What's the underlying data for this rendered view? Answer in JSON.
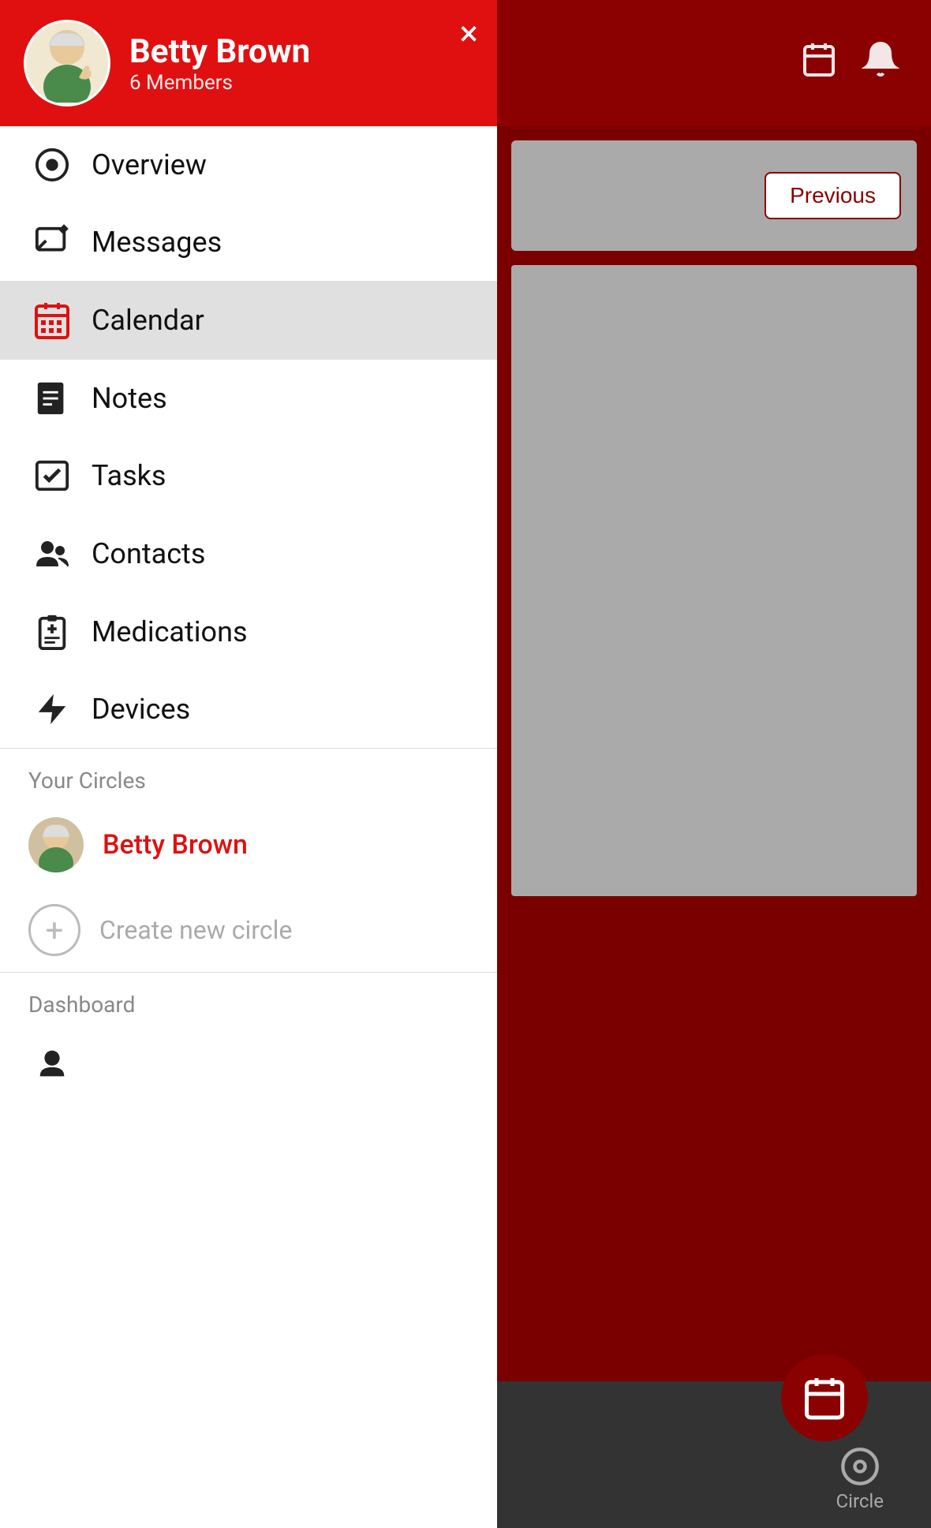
{
  "header": {
    "user_name": "Betty Brown",
    "members": "6 Members",
    "close_label": "×"
  },
  "nav_items": [
    {
      "id": "overview",
      "label": "Overview",
      "icon": "overview",
      "active": false
    },
    {
      "id": "messages",
      "label": "Messages",
      "icon": "messages",
      "active": false
    },
    {
      "id": "calendar",
      "label": "Calendar",
      "icon": "calendar",
      "active": true
    },
    {
      "id": "notes",
      "label": "Notes",
      "icon": "notes",
      "active": false
    },
    {
      "id": "tasks",
      "label": "Tasks",
      "icon": "tasks",
      "active": false
    },
    {
      "id": "contacts",
      "label": "Contacts",
      "icon": "contacts",
      "active": false
    },
    {
      "id": "medications",
      "label": "Medications",
      "icon": "medications",
      "active": false
    },
    {
      "id": "devices",
      "label": "Devices",
      "icon": "devices",
      "active": false
    }
  ],
  "circles_section": {
    "title": "Your Circles",
    "circles": [
      {
        "name": "Betty Brown"
      }
    ],
    "create_label": "Create new circle"
  },
  "dashboard_section": {
    "title": "Dashboard"
  },
  "right_panel": {
    "previous_button": "Previous",
    "circle_label": "Circle"
  },
  "colors": {
    "accent": "#e01010",
    "dark_red": "#8b0000"
  }
}
